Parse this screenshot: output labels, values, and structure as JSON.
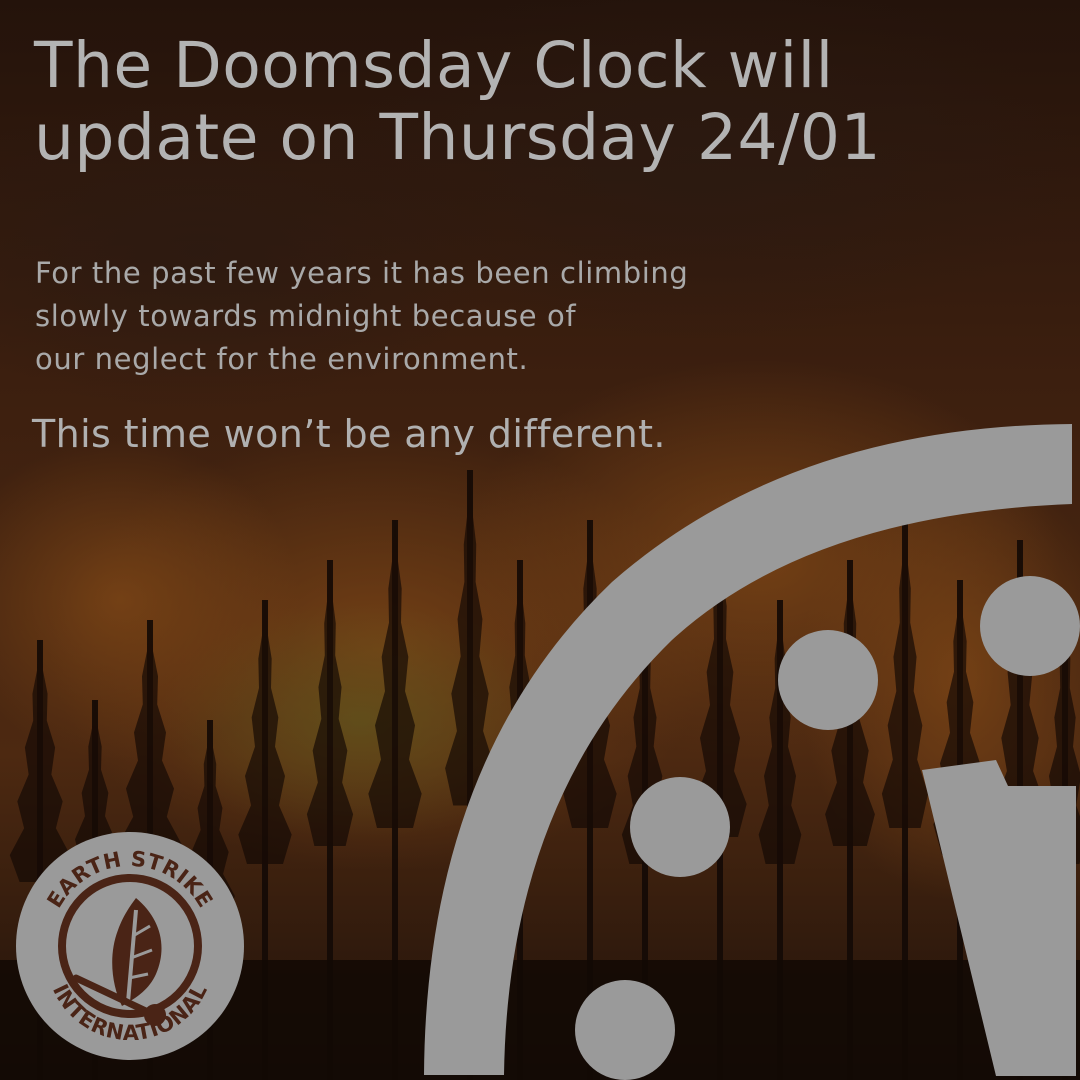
{
  "headline": {
    "line1": "The Doomsday Clock will",
    "line2": "update on Thursday 24/01"
  },
  "body": {
    "line1": "For the past few years it has been climbing",
    "line2": "slowly towards midnight because of",
    "line3": "our neglect for the environment."
  },
  "tagline": "This time won’t be any different.",
  "logo": {
    "top_text": "EARTH STRIKE",
    "bottom_text": "INTERNATIONAL",
    "icon": "leaf-and-match-icon"
  },
  "clock_icon": "doomsday-clock-icon",
  "colors": {
    "text": "#b3b3b3",
    "clock": "#9a9a9a",
    "logo_ring": "#9a9a9a",
    "logo_text": "#4a2416",
    "background_fire": "#6b3614",
    "background_dark": "#1c0e08"
  }
}
